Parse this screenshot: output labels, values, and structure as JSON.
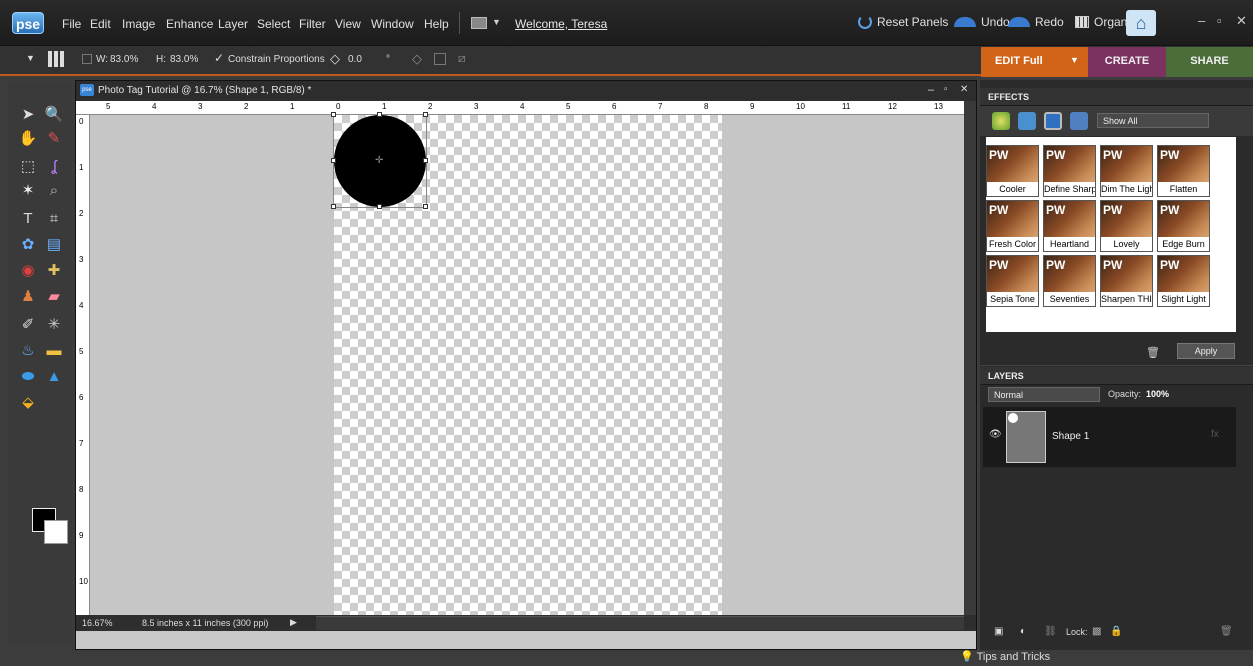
{
  "app": {
    "logo": "pse"
  },
  "menu": [
    "File",
    "Edit",
    "Image",
    "Enhance",
    "Layer",
    "Select",
    "Filter",
    "View",
    "Window",
    "Help"
  ],
  "welcome": "Welcome, Teresa",
  "top_buttons": {
    "reset": "Reset Panels",
    "undo": "Undo",
    "redo": "Redo",
    "organizer": "Organizer"
  },
  "window_controls": {
    "min": "–",
    "max": "▫",
    "close": "✕"
  },
  "options": {
    "w_label": "W:",
    "w_value": "83.0%",
    "h_label": "H:",
    "h_value": "83.0%",
    "constrain": "Constrain Proportions",
    "angle": "0.0",
    "deg": "°"
  },
  "mode_tabs": {
    "edit": "EDIT Full",
    "create": "CREATE",
    "share": "SHARE"
  },
  "document": {
    "title": "Photo Tag Tutorial @ 16.7% (Shape 1, RGB/8) *",
    "zoom": "16.67%",
    "size": "8.5 inches x 11 inches (300 ppi)"
  },
  "ruler": {
    "h": [
      "5",
      "4",
      "3",
      "2",
      "1",
      "0",
      "1",
      "2",
      "3",
      "4",
      "5",
      "6",
      "7",
      "8",
      "9",
      "10",
      "11",
      "12",
      "13"
    ],
    "v": [
      "0",
      "1",
      "2",
      "3",
      "4",
      "5",
      "6",
      "7",
      "8",
      "9",
      "10"
    ]
  },
  "effects": {
    "title": "EFFECTS",
    "filter": "Show All",
    "apply": "Apply",
    "thumbs": [
      [
        "Cooler",
        "Define Sharp",
        "Dim The Lights",
        "Flatten"
      ],
      [
        "Fresh Color",
        "Heartland",
        "Lovely",
        "Edge Burn"
      ],
      [
        "Sepia Tone",
        "Seventies",
        "Sharpen THIS",
        "Slight Light"
      ]
    ],
    "pw": "PW"
  },
  "layers": {
    "title": "LAYERS",
    "blend": "Normal",
    "opacity_label": "Opacity:",
    "opacity": "100%",
    "layer_name": "Shape 1",
    "lock": "Lock:"
  },
  "tips": "Tips and Tricks",
  "colors": {
    "accent": "#d2641a",
    "create": "#7b3260",
    "share": "#4a6d3a"
  }
}
